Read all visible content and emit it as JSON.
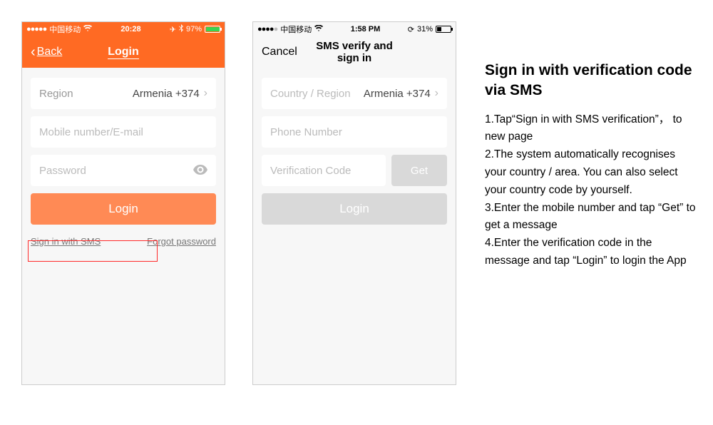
{
  "phone1": {
    "status": {
      "carrier": "中国移动",
      "time": "20:28",
      "battery_pct": "97%"
    },
    "nav": {
      "back": "Back",
      "title": "Login"
    },
    "region_label": "Region",
    "region_value": "Armenia +374",
    "mobile_placeholder": "Mobile number/E-mail",
    "password_placeholder": "Password",
    "login_btn": "Login",
    "sms_link": "Sign in with SMS",
    "forgot_link": "Forgot password"
  },
  "phone2": {
    "status": {
      "carrier": "中国移动",
      "time": "1:58 PM",
      "battery_pct": "31%"
    },
    "nav": {
      "cancel": "Cancel",
      "title": "SMS verify and sign in"
    },
    "region_label": "Country / Region",
    "region_value": "Armenia +374",
    "phone_placeholder": "Phone Number",
    "code_placeholder": "Verification Code",
    "get_btn": "Get",
    "login_btn": "Login"
  },
  "instructions": {
    "title": "Sign in with verification code via SMS",
    "step1": "1.Tap“Sign in with SMS verification”， to new page",
    "step2": "2.The system automatically recognises your country / area. You can also select your country code by yourself.",
    "step3": "3.Enter the mobile number and tap “Get” to get a message",
    "step4": "4.Enter the verification code in the message and tap “Login” to login the App"
  }
}
